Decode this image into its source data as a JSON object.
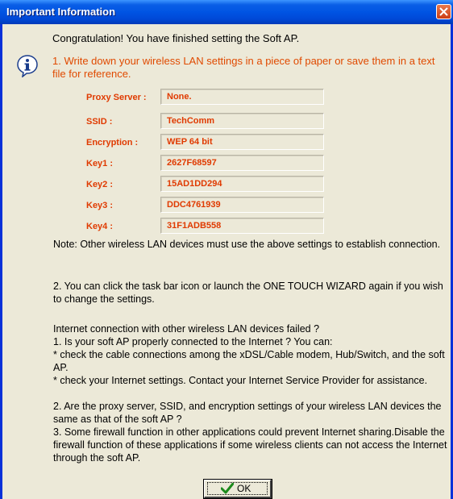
{
  "window": {
    "title": "Important Information",
    "close_icon": "close-x"
  },
  "icon": "info-icon",
  "congrats": "Congratulation! You have finished setting the Soft AP.",
  "step1": "1. Write down your wireless LAN settings in a piece of paper or save them in a text file for reference.",
  "settings": [
    {
      "label": "Proxy Server :",
      "value": "None."
    },
    {
      "label": "SSID :",
      "value": "TechComm"
    },
    {
      "label": "Encryption :",
      "value": "WEP 64 bit"
    },
    {
      "label": "Key1 :",
      "value": "2627F68597"
    },
    {
      "label": "Key2 :",
      "value": "15AD1DD294"
    },
    {
      "label": "Key3 :",
      "value": "DDC4761939"
    },
    {
      "label": "Key4 :",
      "value": "31F1ADB558"
    }
  ],
  "note": "Note: Other wireless LAN devices must use the above settings to establish connection.",
  "step2": "2. You can click the task bar icon or launch the ONE TOUCH WIZARD again if you wish to change the settings.",
  "troubleshoot": {
    "heading": "Internet connection with other wireless LAN devices failed ?",
    "q1": "1. Is your soft AP properly connected to the Internet ? You can:",
    "q1_a": "   * check the cable connections among the xDSL/Cable modem, Hub/Switch, and the soft AP.",
    "q1_b": "   * check your Internet settings. Contact your Internet Service Provider for assistance.",
    "q2": "2. Are the proxy server, SSID, and encryption settings of your wireless LAN devices the same as that of the soft AP ?",
    "q3": "3. Some firewall function in other applications could prevent Internet sharing.Disable the firewall function of these applications if some wireless clients can not access the Internet through the soft AP."
  },
  "ok_button": {
    "label": "OK",
    "icon": "checkmark-icon"
  },
  "colors": {
    "titlebar": "#0054e3",
    "highlight_text": "#e04a00",
    "dialog_bg": "#ece9d8"
  }
}
